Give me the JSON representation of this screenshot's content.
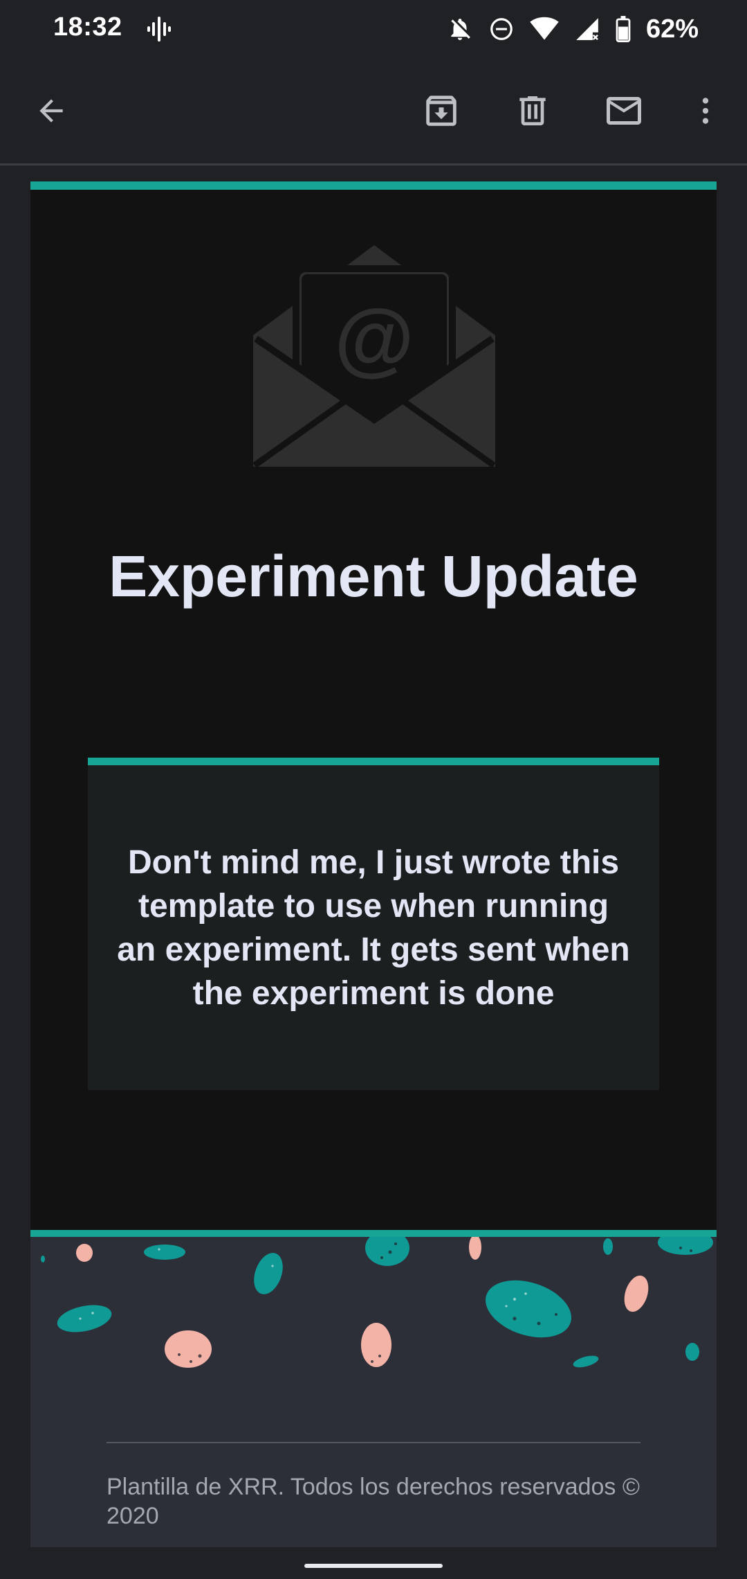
{
  "status_bar": {
    "time": "18:32",
    "battery_percent": "62%",
    "icons": [
      "podcast-icon",
      "notifications-off-icon",
      "do-not-disturb-icon",
      "wifi-icon",
      "signal-icon",
      "battery-icon"
    ]
  },
  "toolbar": {
    "back_icon": "arrow-back-icon",
    "actions": [
      "archive-icon",
      "delete-icon",
      "mark-unread-icon",
      "more-vert-icon"
    ]
  },
  "email": {
    "header_icon": "open-envelope-at-icon",
    "title": "Experiment Update",
    "body": "Don't mind me, I just wrote this template to use when running an experiment. It gets sent when the experiment is done",
    "footer_text": "Plantilla de XRR. Todos los derechos reservados © 2020"
  },
  "colors": {
    "accent": "#17a596",
    "card_background": "#1c1f20",
    "hero_background": "#121212",
    "footer_background": "#2c2e38",
    "title_text": "#e3e6f5",
    "egg_teal": "#0f9a96",
    "egg_pink": "#f4b3a7"
  }
}
